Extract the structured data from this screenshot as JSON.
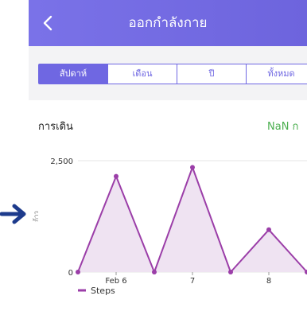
{
  "header": {
    "title": "ออกกำลังกาย",
    "back_icon": "chevron-left-icon",
    "bg": "#6f67e2"
  },
  "tabs": [
    {
      "label": "สัปดาห์",
      "active": true
    },
    {
      "label": "เดือน",
      "active": false
    },
    {
      "label": "ปี",
      "active": false
    },
    {
      "label": "ทั้งหมด",
      "active": false
    }
  ],
  "section": {
    "title": "การเดิน",
    "value": "NaN ก"
  },
  "chart_data": {
    "type": "area",
    "title": "",
    "xlabel": "",
    "ylabel": "ก้าว",
    "ylim": [
      0,
      2500
    ],
    "y_ticks": [
      "0",
      "2,500"
    ],
    "x_ticks": [
      "Feb 6",
      "7",
      "8"
    ],
    "grid": true,
    "legend_position": "bottom-left",
    "color": "#9b3ea8",
    "fill": "#efe3f2",
    "series": [
      {
        "name": "Steps",
        "points": [
          {
            "x": "Feb 5.5",
            "y": 0
          },
          {
            "x": "Feb 6",
            "y": 2150
          },
          {
            "x": "Feb 6.5",
            "y": 0
          },
          {
            "x": "Feb 7",
            "y": 2350
          },
          {
            "x": "Feb 7.5",
            "y": 0
          },
          {
            "x": "Feb 8",
            "y": 950
          },
          {
            "x": "Feb 8.5",
            "y": 0
          }
        ]
      }
    ]
  },
  "annotation_arrow_color": "#1d3b8c"
}
